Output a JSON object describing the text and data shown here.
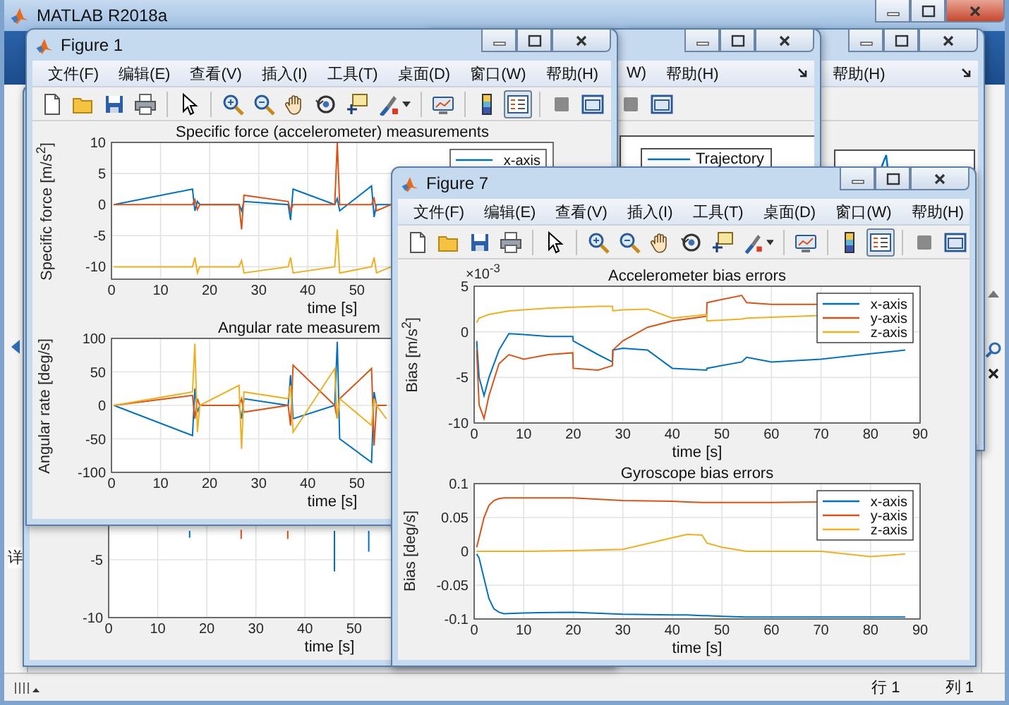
{
  "main_window": {
    "title": "MATLAB R2018a",
    "side_label": "详",
    "status_bar": {
      "row": "行 1",
      "column": "列 1"
    }
  },
  "figures": [
    {
      "axes": [
        {
          "chart_data": {
            "type": "line",
            "grid": true,
            "xlabel": "time [s]",
            "x": [
              16.5,
              16.5,
              27,
              27,
              46,
              46,
              36.5,
              36.5,
              53,
              53
            ],
            "xlim": [
              0,
              90
            ],
            "ylim": [
              -10,
              10
            ],
            "xticks": [
              0,
              10,
              20,
              30,
              40,
              50
            ],
            "yticks": [
              -10,
              -5
            ],
            "series": [
              {
                "color": "#0072bd",
                "values": [
                  -2.5,
                  -3.1,
                  null,
                  null,
                  -2.5,
                  -6,
                  null,
                  null,
                  -2.5,
                  -4.3
                ]
              },
              {
                "color": "#d95319",
                "values": [
                  null,
                  null,
                  -2.4,
                  -3.2,
                  null,
                  null,
                  -2.5,
                  -3.2,
                  null,
                  null
                ]
              }
            ]
          }
        }
      ]
    },
    {
      "menu": [
        "W)",
        "帮助(H)"
      ],
      "toolbar": [
        {
          "kind": "hide-tools",
          "pressed": false
        },
        {
          "kind": "show-tools",
          "pressed": false
        }
      ],
      "plot": {
        "kind": "legend",
        "legend_label": "Trajectory"
      }
    },
    {
      "menu": [
        "帮助(H)"
      ],
      "plot": {
        "kind": "spike"
      }
    },
    {
      "title": "Figure 1",
      "menu": [
        "文件(F)",
        "编辑(E)",
        "查看(V)",
        "插入(I)",
        "工具(T)",
        "桌面(D)",
        "窗口(W)",
        "帮助(H)"
      ],
      "toolbar": [
        {
          "kind": "new",
          "pressed": false
        },
        {
          "kind": "open",
          "pressed": false
        },
        {
          "kind": "save",
          "pressed": false
        },
        {
          "kind": "print",
          "pressed": false
        },
        {
          "kind": "separator"
        },
        {
          "kind": "pointer",
          "pressed": false
        },
        {
          "kind": "separator"
        },
        {
          "kind": "zoom-in",
          "pressed": false
        },
        {
          "kind": "zoom-out",
          "pressed": false
        },
        {
          "kind": "pan",
          "pressed": false
        },
        {
          "kind": "rotate",
          "pressed": false
        },
        {
          "kind": "data-cursor",
          "pressed": false
        },
        {
          "kind": "brush",
          "pressed": false
        },
        {
          "kind": "separator"
        },
        {
          "kind": "link",
          "pressed": false
        },
        {
          "kind": "separator"
        },
        {
          "kind": "colorbar",
          "pressed": false
        },
        {
          "kind": "legend",
          "pressed": true
        },
        {
          "kind": "separator"
        },
        {
          "kind": "hide-tools",
          "pressed": false
        },
        {
          "kind": "show-tools",
          "pressed": false
        }
      ],
      "axes": [
        {
          "chart_data": {
            "type": "line",
            "grid": true,
            "legend": true,
            "title": "Specific force (accelerometer) measurements",
            "xlabel": "time [s]",
            "ylabel": "Specific force [m/s$^{2}$]",
            "x": [
              0.5,
              16.5,
              17,
              17.5,
              18,
              26,
              26.5,
              27,
              36,
              36.5,
              37,
              45.5,
              46,
              46.5,
              53,
              53.5,
              54,
              57
            ],
            "xlim": [
              0,
              90
            ],
            "ylim": [
              -12,
              10
            ],
            "xticks": [
              0,
              10,
              20,
              30,
              40,
              50
            ],
            "yticks": [
              -10,
              -5,
              0,
              5,
              10
            ],
            "series": [
              {
                "name": "x-axis",
                "color": "#0072bd",
                "values": [
                  0,
                  2.5,
                  -1,
                  0.5,
                  0,
                  0,
                  -1,
                  0.5,
                  0,
                  -2.5,
                  2.5,
                  0,
                  1,
                  -1,
                  3,
                  -2,
                  0,
                  0
                ]
              },
              {
                "color": "#d95319",
                "values": [
                  0,
                  0,
                  0.8,
                  -0.8,
                  0,
                  0,
                  -4,
                  1.5,
                  0.5,
                  -1,
                  0,
                  0,
                  10,
                  0,
                  0,
                  1,
                  -1,
                  0
                ]
              },
              {
                "color": "#edb120",
                "values": [
                  -10,
                  -10,
                  -8.5,
                  -11,
                  -10,
                  -10,
                  -9,
                  -11,
                  -10,
                  -8.5,
                  -11,
                  -10,
                  -4,
                  -11,
                  -10,
                  -8.5,
                  -11,
                  -10
                ]
              }
            ]
          }
        },
        {
          "chart_data": {
            "type": "line",
            "grid": true,
            "title": "Angular rate measurem",
            "xlabel": "time [s]",
            "ylabel": "Angular rate [deg/s]",
            "x": [
              0.5,
              16.5,
              17,
              17.5,
              18,
              26,
              26.5,
              27,
              36,
              36.5,
              37,
              45.5,
              46,
              46.5,
              53,
              53.5,
              54,
              56
            ],
            "xlim": [
              0,
              90
            ],
            "ylim": [
              -100,
              100
            ],
            "xticks": [
              0,
              10,
              20,
              30,
              40,
              50
            ],
            "yticks": [
              -100,
              -50,
              0,
              50,
              100
            ],
            "series": [
              {
                "color": "#0072bd",
                "values": [
                  0,
                  -45,
                  25,
                  -10,
                  0,
                  0,
                  -20,
                  10,
                  0,
                  45,
                  -20,
                  0,
                  95,
                  -50,
                  -85,
                  20,
                  0,
                  0
                ]
              },
              {
                "color": "#d95319",
                "values": [
                  0,
                  15,
                  -20,
                  10,
                  0,
                  0,
                  10,
                  -10,
                  0,
                  -30,
                  60,
                  0,
                  -20,
                  10,
                  55,
                  -60,
                  0,
                  0
                ]
              },
              {
                "color": "#edb120",
                "values": [
                  0,
                  20,
                  92,
                  -40,
                  0,
                  30,
                  -65,
                  20,
                  10,
                  30,
                  -40,
                  55,
                  -20,
                  10,
                  -30,
                  10,
                  0,
                  -20
                ]
              }
            ]
          }
        }
      ]
    },
    {
      "title": "Figure 7",
      "menu": [
        "文件(F)",
        "编辑(E)",
        "查看(V)",
        "插入(I)",
        "工具(T)",
        "桌面(D)",
        "窗口(W)",
        "帮助(H)"
      ],
      "toolbar": [
        {
          "kind": "new",
          "pressed": false
        },
        {
          "kind": "open",
          "pressed": false
        },
        {
          "kind": "save",
          "pressed": false
        },
        {
          "kind": "print",
          "pressed": false
        },
        {
          "kind": "separator"
        },
        {
          "kind": "pointer",
          "pressed": false
        },
        {
          "kind": "separator"
        },
        {
          "kind": "zoom-in",
          "pressed": false
        },
        {
          "kind": "zoom-out",
          "pressed": false
        },
        {
          "kind": "pan",
          "pressed": false
        },
        {
          "kind": "rotate",
          "pressed": false
        },
        {
          "kind": "data-cursor",
          "pressed": false
        },
        {
          "kind": "brush",
          "pressed": false
        },
        {
          "kind": "separator"
        },
        {
          "kind": "link",
          "pressed": false
        },
        {
          "kind": "separator"
        },
        {
          "kind": "colorbar",
          "pressed": false
        },
        {
          "kind": "legend",
          "pressed": true
        },
        {
          "kind": "separator"
        },
        {
          "kind": "hide-tools",
          "pressed": false
        },
        {
          "kind": "show-tools",
          "pressed": false
        }
      ],
      "axes": [
        {
          "chart_data": {
            "type": "line",
            "grid": true,
            "legend": true,
            "title": "Accelerometer bias errors",
            "xlabel": "time [s]",
            "ylabel": "Bias [m/s$^{2}$]",
            "annotations": [
              {
                "text": "×10$^{-3}$"
              }
            ],
            "x": [
              0.5,
              1,
              2,
              3,
              5,
              7,
              10,
              15,
              19.9,
              20,
              25,
              27.9,
              28,
              30,
              35,
              40,
              46.9,
              47,
              54,
              55,
              60,
              70,
              80,
              87
            ],
            "xlim": [
              0,
              90
            ],
            "ylim": [
              -10,
              5
            ],
            "xticks": [
              0,
              10,
              20,
              30,
              40,
              50,
              60,
              70,
              80,
              90
            ],
            "yticks": [
              -10,
              -5,
              0,
              5
            ],
            "series": [
              {
                "name": "x-axis",
                "color": "#0072bd",
                "values": [
                  -1,
                  -5,
                  -7,
                  -5,
                  -2,
                  -0.2,
                  -0.3,
                  -0.5,
                  -0.5,
                  -1,
                  -2.5,
                  -3.3,
                  -2,
                  -1.8,
                  -2,
                  -4,
                  -4.2,
                  -4,
                  -3.3,
                  -2.8,
                  -3.3,
                  -3,
                  -2.4,
                  -2
                ]
              },
              {
                "name": "y-axis",
                "color": "#d95319",
                "values": [
                  -2,
                  -8,
                  -9.5,
                  -7,
                  -3.5,
                  -2.5,
                  -3,
                  -2.5,
                  -2.3,
                  -4,
                  -4.2,
                  -3.7,
                  -2,
                  -1,
                  0.5,
                  1.2,
                  1.7,
                  3.2,
                  4,
                  3.2,
                  3,
                  3,
                  null,
                  null
                ]
              },
              {
                "name": "z-axis",
                "color": "#edb120",
                "values": [
                  1,
                  1.5,
                  1.7,
                  1.9,
                  2.1,
                  2.3,
                  2.4,
                  2.6,
                  2.7,
                  2.7,
                  2.8,
                  2.8,
                  2.3,
                  2.4,
                  2.5,
                  1.5,
                  1.9,
                  1.2,
                  1.4,
                  1.5,
                  1.6,
                  1.8,
                  null,
                  null
                ]
              }
            ]
          }
        },
        {
          "chart_data": {
            "type": "line",
            "grid": true,
            "legend": true,
            "title": "Gyroscope bias errors",
            "xlabel": "time [s]",
            "ylabel": "Bias [deg/s]",
            "x": [
              0.5,
              1,
              2,
              3,
              4,
              5,
              6,
              10,
              20,
              30,
              40,
              43,
              46,
              47,
              50,
              55,
              60,
              70,
              80,
              87
            ],
            "xlim": [
              0,
              90
            ],
            "ylim": [
              -0.1,
              0.1
            ],
            "xticks": [
              0,
              10,
              20,
              30,
              40,
              50,
              60,
              70,
              80,
              90
            ],
            "yticks": [
              -0.1,
              -0.05,
              0,
              0.05,
              0.1
            ],
            "series": [
              {
                "name": "x-axis",
                "color": "#0072bd",
                "values": [
                  -0.004,
                  -0.01,
                  -0.04,
                  -0.07,
                  -0.085,
                  -0.09,
                  -0.092,
                  -0.091,
                  -0.09,
                  -0.093,
                  -0.094,
                  -0.094,
                  -0.095,
                  -0.095,
                  -0.096,
                  -0.097,
                  -0.097,
                  -0.097,
                  -0.097,
                  -0.097
                ]
              },
              {
                "name": "y-axis",
                "color": "#d95319",
                "values": [
                  0.006,
                  0.02,
                  0.05,
                  0.068,
                  0.075,
                  0.078,
                  0.079,
                  0.079,
                  0.079,
                  0.075,
                  0.074,
                  0.073,
                  0.072,
                  0.072,
                  0.072,
                  0.072,
                  0.072,
                  0.073,
                  null,
                  null
                ]
              },
              {
                "name": "z-axis",
                "color": "#edb120",
                "values": [
                  0,
                  0,
                  0,
                  0,
                  0,
                  0,
                  0,
                  0,
                  0.001,
                  0.003,
                  0.02,
                  0.025,
                  0.024,
                  0.012,
                  0.006,
                  0,
                  0,
                  0,
                  -0.008,
                  -0.004
                ]
              }
            ]
          }
        }
      ]
    }
  ]
}
